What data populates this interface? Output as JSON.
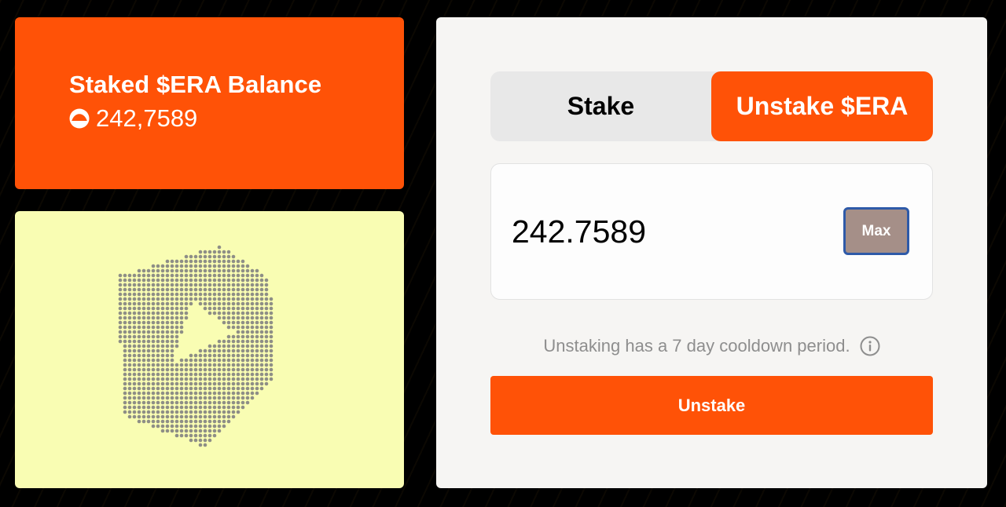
{
  "balance_card": {
    "title": "Staked $ERA Balance",
    "coin_icon": "era-coin-icon",
    "value": "242,7589"
  },
  "art_card": {
    "icon": "era-hexagon-logo-art",
    "background": "#F9FDB3",
    "dot_color": "#8E8E86"
  },
  "tabs": [
    {
      "label": "Stake",
      "active": false
    },
    {
      "label": "Unstake $ERA",
      "active": true
    }
  ],
  "amount": {
    "value": "242.7589",
    "max_label": "Max"
  },
  "cooldown": {
    "text": "Unstaking has a 7 day cooldown period.",
    "icon": "info-icon"
  },
  "action": {
    "label": "Unstake"
  },
  "colors": {
    "accent": "#FF5207",
    "page_background": "#000000",
    "panel_background": "#F6F5F3",
    "max_button": "#A58F88",
    "max_button_border": "#2E5AA8"
  }
}
